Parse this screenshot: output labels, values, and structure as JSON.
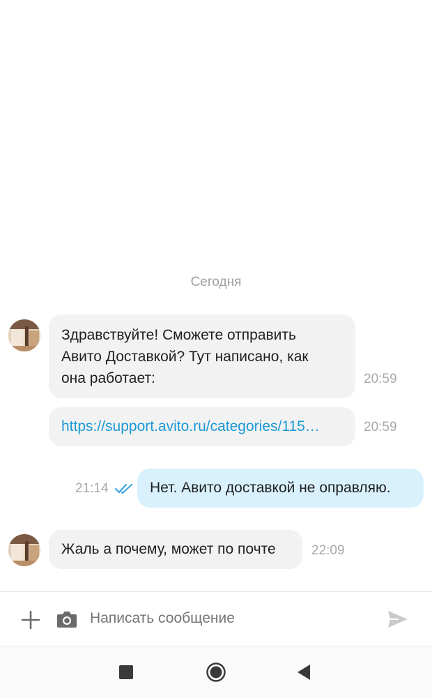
{
  "chat": {
    "date_separator": "Сегодня",
    "messages": [
      {
        "direction": "incoming",
        "text_lines": [
          "Здравствуйте! Сможете отправить",
          "Авито Доставкой? Тут написано, как",
          "она работает:"
        ],
        "time": "20:59"
      },
      {
        "direction": "incoming",
        "link": "https://support.avito.ru/categories/115…",
        "time": "20:59"
      },
      {
        "direction": "outgoing",
        "text": "Нет. Авито доставкой не оправляю.",
        "time": "21:14",
        "status": "read"
      },
      {
        "direction": "incoming",
        "text": "Жаль а почему, может по почте",
        "time": "22:09"
      }
    ]
  },
  "composer": {
    "placeholder": "Написать сообщение",
    "icons": [
      "plus-icon",
      "camera-icon",
      "send-icon"
    ]
  },
  "navbar": {
    "icons": [
      "recents-square-icon",
      "home-circle-icon",
      "back-triangle-icon"
    ]
  },
  "colors": {
    "incoming_bubble": "#f2f2f2",
    "outgoing_bubble": "#d9f1fd",
    "link": "#1a99d6",
    "read_check": "#3aa3e3"
  }
}
